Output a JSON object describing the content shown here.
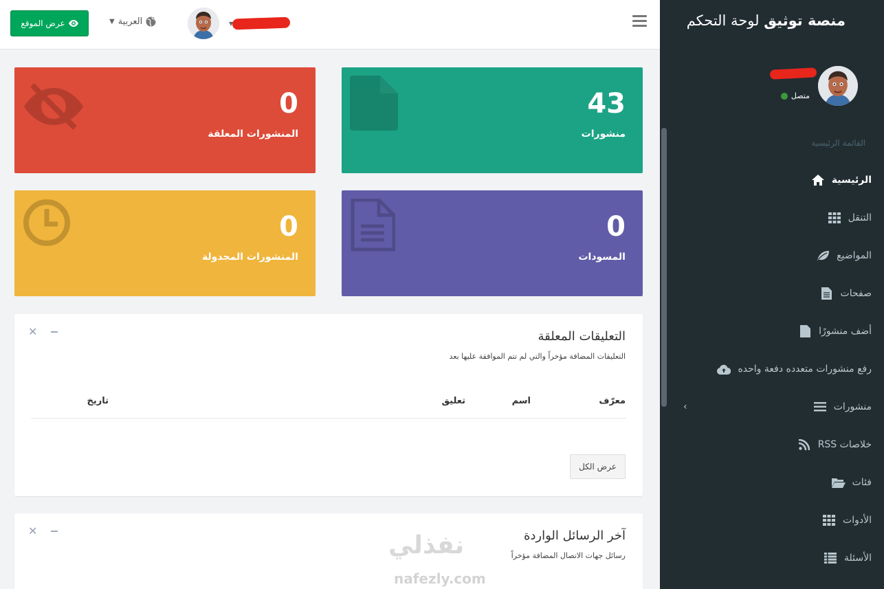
{
  "header": {
    "view_site_label": "عرض الموقع",
    "language_label": "العربية"
  },
  "sidebar": {
    "brand_bold": "منصة توثيق",
    "brand_rest": " لوحة التحكم",
    "status_label": "متصل",
    "menu_header": "القائمة الرئيسية",
    "items": [
      {
        "label": "الرئيسية",
        "icon": "home-icon"
      },
      {
        "label": "التنقل",
        "icon": "grid-icon"
      },
      {
        "label": "المواضيع",
        "icon": "leaf-icon"
      },
      {
        "label": "صفحات",
        "icon": "file-text-icon"
      },
      {
        "label": "أضف منشورًا",
        "icon": "file-icon"
      },
      {
        "label": "رفع منشورات متعدده دفعة واحده",
        "icon": "cloud-upload-icon"
      },
      {
        "label": "منشورات",
        "icon": "list-icon"
      },
      {
        "label": "خلاصات RSS",
        "icon": "rss-icon"
      },
      {
        "label": "فئات",
        "icon": "folder-open-icon"
      },
      {
        "label": "الأدوات",
        "icon": "grid-icon"
      },
      {
        "label": "الأسئلة",
        "icon": "list-alt-icon"
      }
    ]
  },
  "stats": {
    "posts": {
      "value": "43",
      "label": "منشورات",
      "color": "#1ca385"
    },
    "pending": {
      "value": "0",
      "label": "المنشورات المعلقة",
      "color": "#dd4b39"
    },
    "drafts": {
      "value": "0",
      "label": "المسودات",
      "color": "#605ca8"
    },
    "scheduled": {
      "value": "0",
      "label": "المنشورات المجدولة",
      "color": "#f0b53c"
    }
  },
  "pending_comments": {
    "title": "التعليقات المعلقة",
    "subtitle": "التعليقات المضافة مؤخراً والتي لم تتم الموافقة عليها بعد",
    "columns": [
      "معرّف",
      "اسم",
      "تعليق",
      "تاريخ"
    ],
    "view_all": "عرض الكل"
  },
  "latest_messages": {
    "title": "آخر الرسائل الواردة",
    "subtitle": "رسائل جهات الاتصال المضافة مؤخراً"
  },
  "watermark": {
    "ar": "نفذلي",
    "en": "nafezly.com"
  }
}
